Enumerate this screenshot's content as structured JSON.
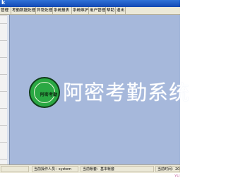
{
  "window": {
    "title_glyph": "k"
  },
  "menu": [
    "管理",
    "考勤数据处理",
    "异常处理",
    "系统报表",
    "系统维护",
    "用户管理",
    "帮助",
    "退出"
  ],
  "main": {
    "logo_caption": "阿密考勤",
    "watermark": "阿密考勤系统"
  },
  "status": {
    "left": "",
    "operator": "当前操作人员：system",
    "account": "当前帐套：基本帐套",
    "time": "当前时间：20"
  },
  "branding": {
    "watermark_small": "YU"
  }
}
